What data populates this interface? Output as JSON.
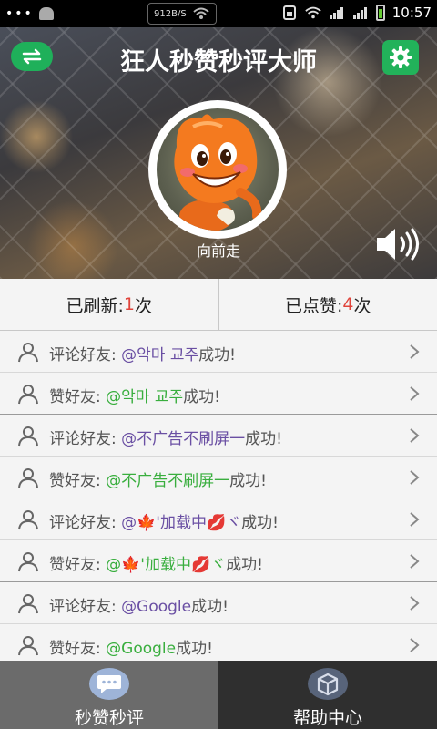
{
  "status_bar": {
    "network_speed": "912B/S",
    "time": "10:57"
  },
  "header": {
    "title": "狂人秒赞秒评大师",
    "username": "向前走"
  },
  "stats": {
    "refreshed_label": "已刷新:",
    "refreshed_count": "1",
    "refreshed_unit": "次",
    "liked_label": "已点赞:",
    "liked_count": "4",
    "liked_unit": "次"
  },
  "feed": [
    {
      "action": "评论好友: ",
      "name": "@악마 교주",
      "suffix": "成功!",
      "color": "purple"
    },
    {
      "action": "赞好友: ",
      "name": "@악마 교주",
      "suffix": "成功!",
      "color": "green"
    },
    {
      "action": "评论好友: ",
      "name": "@不广告不刷屏一",
      "suffix": "成功!",
      "color": "purple"
    },
    {
      "action": "赞好友: ",
      "name": "@不广告不刷屏一",
      "suffix": "成功!",
      "color": "green"
    },
    {
      "action": "评论好友: ",
      "name": "@🍁'加载中💋ヾ",
      "suffix": "成功!",
      "color": "purple"
    },
    {
      "action": "赞好友: ",
      "name": "@🍁'加载中💋ヾ",
      "suffix": "成功!",
      "color": "green"
    },
    {
      "action": "评论好友: ",
      "name": "@Google",
      "suffix": "成功!",
      "color": "purple"
    },
    {
      "action": "赞好友: ",
      "name": "@Google",
      "suffix": "成功!",
      "color": "green"
    }
  ],
  "tabs": [
    {
      "label": "秒赞秒评",
      "icon": "chat-bubble-icon"
    },
    {
      "label": "帮助中心",
      "icon": "cube-icon"
    }
  ],
  "colors": {
    "accent_green": "#22b25a",
    "count_red": "#e0433a",
    "name_purple": "#6a4fa3",
    "name_green": "#39ae3e"
  }
}
